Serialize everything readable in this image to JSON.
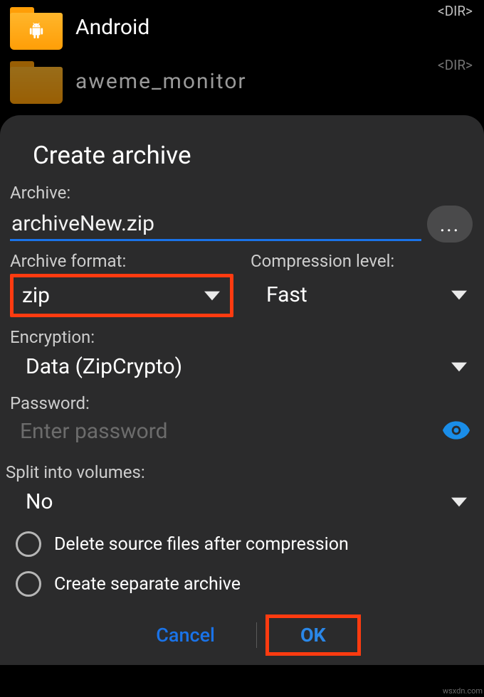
{
  "background": {
    "files": [
      {
        "name": "Android",
        "tag": "<DIR>",
        "icon": "android"
      },
      {
        "name": "aweme_monitor",
        "tag": "<DIR>",
        "icon": "folder"
      }
    ]
  },
  "dialog": {
    "title": "Create archive",
    "archive": {
      "label": "Archive:",
      "value": "archiveNew.zip",
      "more_label": "..."
    },
    "format": {
      "label": "Archive format:",
      "value": "zip"
    },
    "compression": {
      "label": "Compression level:",
      "value": "Fast"
    },
    "encryption": {
      "label": "Encryption:",
      "value": "Data (ZipCrypto)"
    },
    "password": {
      "label": "Password:",
      "placeholder": "Enter password"
    },
    "split": {
      "label": "Split into volumes:",
      "value": "No"
    },
    "delete_source_label": "Delete source files after compression",
    "separate_archive_label": "Create separate archive",
    "cancel_label": "Cancel",
    "ok_label": "OK"
  },
  "watermark": "wsxdn.com"
}
